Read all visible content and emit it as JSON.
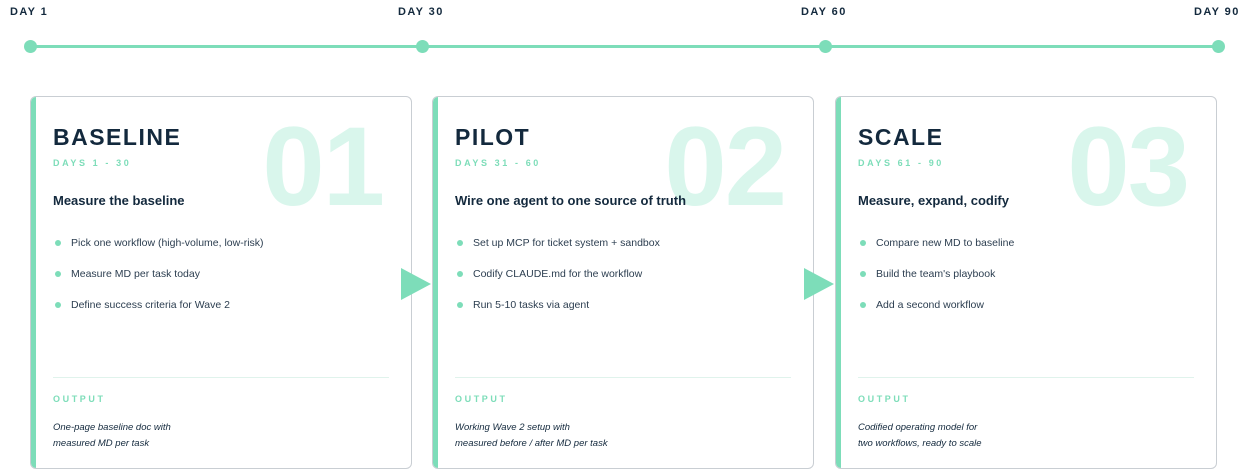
{
  "timeline": {
    "days": [
      "DAY 1",
      "DAY 30",
      "DAY 60",
      "DAY 90"
    ]
  },
  "phases": [
    {
      "number": "01",
      "name": "BASELINE",
      "days": "DAYS 1 - 30",
      "headline": "Measure the baseline",
      "tasks": [
        "Pick one workflow (high-volume, low-risk)",
        "Measure MD per task today",
        "Define success criteria for Wave 2"
      ],
      "output_label": "OUTPUT",
      "output": "One-page baseline doc with\nmeasured MD per task"
    },
    {
      "number": "02",
      "name": "PILOT",
      "days": "DAYS 31 - 60",
      "headline": "Wire one agent to one source of truth",
      "tasks": [
        "Set up MCP for ticket system + sandbox",
        "Codify CLAUDE.md for the workflow",
        "Run 5-10 tasks via agent"
      ],
      "output_label": "OUTPUT",
      "output": "Working Wave 2 setup with\nmeasured before / after MD per task"
    },
    {
      "number": "03",
      "name": "SCALE",
      "days": "DAYS 61 - 90",
      "headline": "Measure, expand, codify",
      "tasks": [
        "Compare new MD to baseline",
        "Build the team's playbook",
        "Add a second workflow"
      ],
      "output_label": "OUTPUT",
      "output": "Codified operating model for\ntwo workflows, ready to scale"
    }
  ],
  "colors": {
    "accent": "#7dddb9",
    "number_tint": "#d9f6ec",
    "heading": "#13293d",
    "card_border": "#c9ced3"
  }
}
